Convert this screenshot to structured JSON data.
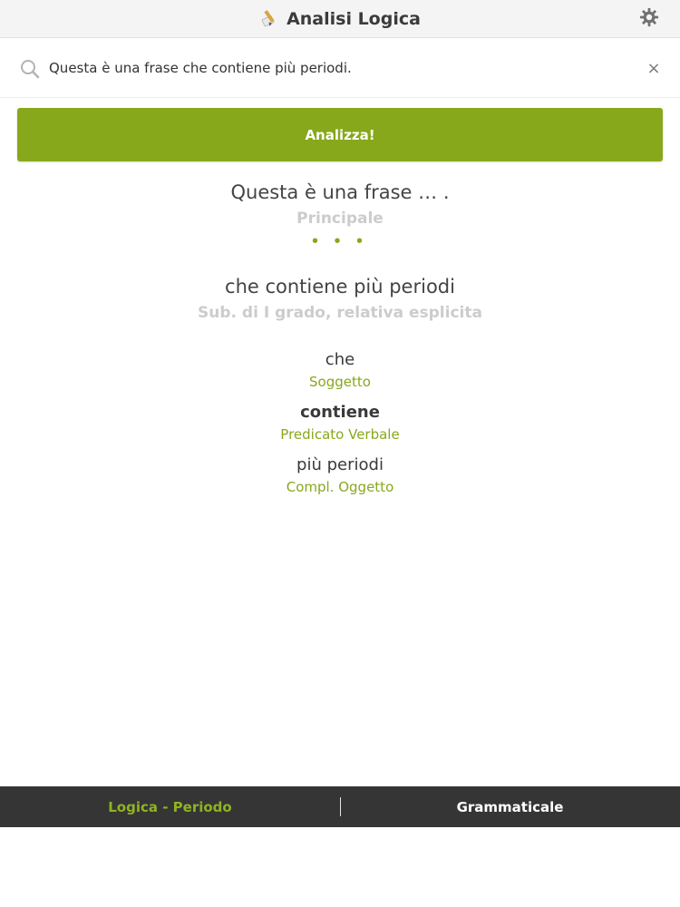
{
  "header": {
    "title": "Analisi Logica",
    "logo_icon": "pencil-eraser-icon",
    "settings_icon": "gear-icon"
  },
  "search": {
    "value": "Questa è una frase che contiene più periodi.",
    "placeholder": "",
    "search_icon": "search-icon",
    "clear_symbol": "×"
  },
  "analyze_button": {
    "label": "Analizza!"
  },
  "results": {
    "clauses": [
      {
        "text": "Questa è una frase … .",
        "type": "Principale",
        "dots": "• • •"
      },
      {
        "text": "che contiene più periodi",
        "type": "Sub. di I grado, relativa esplicita",
        "parts": [
          {
            "word": "che",
            "role": "Soggetto"
          },
          {
            "word": "contiene",
            "role": "Predicato Verbale"
          },
          {
            "word": "più periodi",
            "role": "Compl. Oggetto"
          }
        ]
      }
    ]
  },
  "tabs": [
    {
      "label": "Logica - Periodo",
      "active": true
    },
    {
      "label": "Grammaticale",
      "active": false
    }
  ],
  "colors": {
    "accent": "#88a81c",
    "tabbar_bg": "#353535",
    "muted_type": "#cccccc"
  }
}
